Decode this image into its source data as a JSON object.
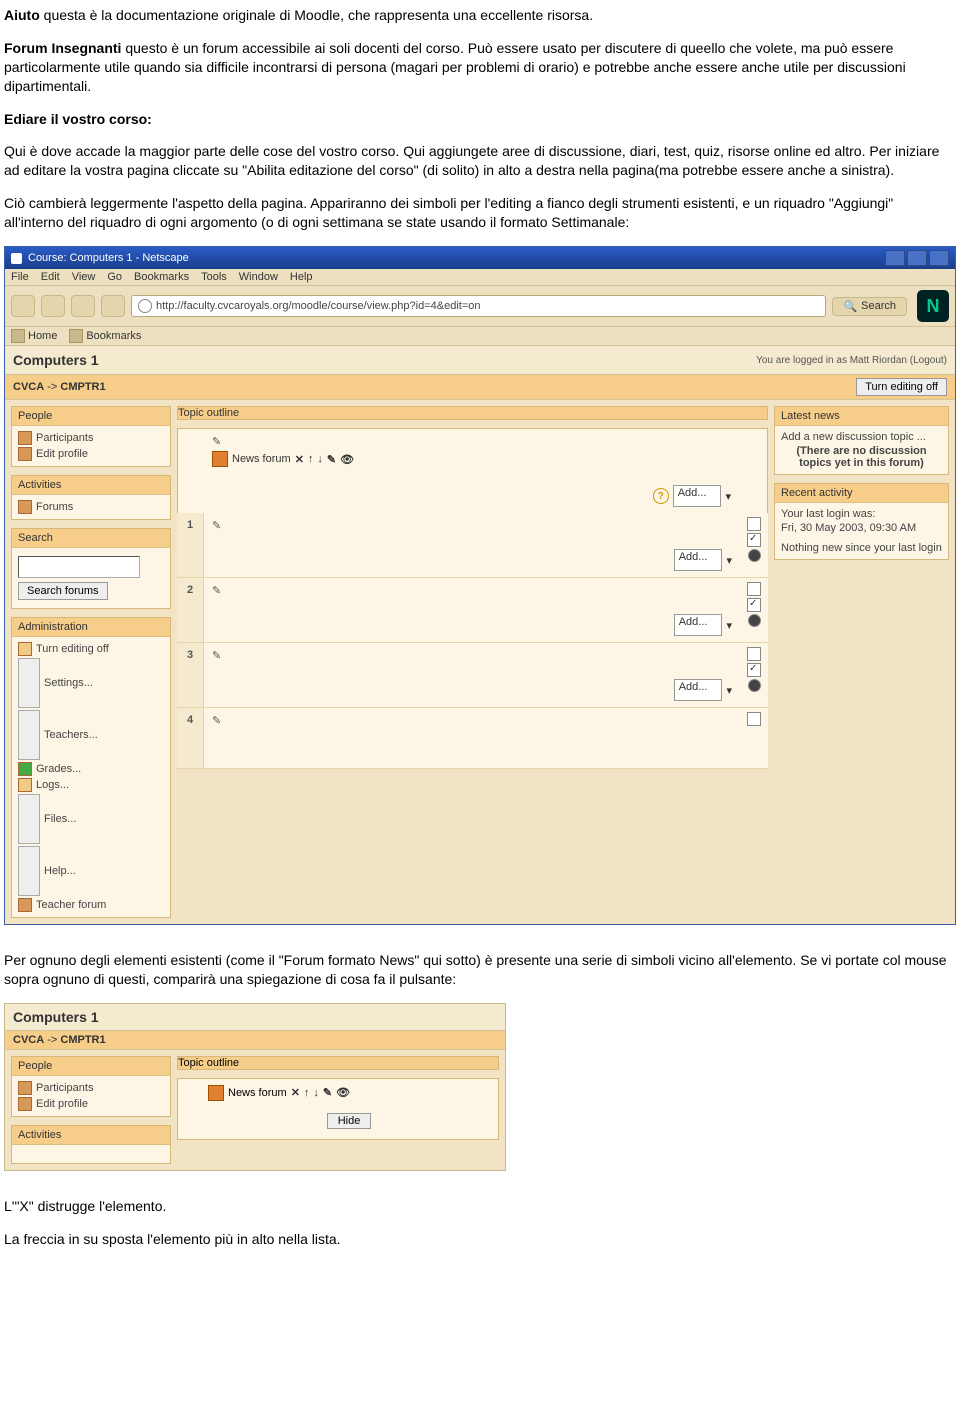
{
  "doc": {
    "p1_b": "Aiuto",
    "p1": " questa è la documentazione originale di Moodle, che rappresenta una eccellente risorsa.",
    "p2_b": "Forum Insegnanti",
    "p2": " questo è un forum accessibile ai soli docenti del corso. Può essere usato per discutere di queello che volete, ma può essere particolarmente utile quando sia difficile incontrarsi di persona (magari per problemi di orario) e potrebbe anche essere anche utile per discussioni dipartimentali.",
    "h1": "Ediare il vostro corso:",
    "p3": "Qui è dove accade la maggior parte delle cose del vostro corso. Qui aggiungete aree di discussione, diari, test, quiz, risorse online ed altro. Per iniziare ad editare la vostra pagina cliccate su \"Abilita editazione del corso\" (di solito) in alto a destra nella pagina(ma potrebbe essere anche a sinistra).",
    "p4": "Ciò cambierà leggermente l'aspetto della pagina. Appariranno dei simboli per l'editing a fianco degli strumenti esistenti, e un riquadro \"Aggiungi\" all'interno del riquadro di ogni argomento (o di ogni settimana se state usando il formato Settimanale:",
    "p5": "Per ognuno degli elementi esistenti (come il \"Forum formato News\" qui sotto) è presente una serie di simboli vicino all'elemento. Se vi portate col mouse sopra ognuno di questi, comparirà una spiegazione di cosa fa il pulsante:",
    "p6": "L'\"X\" distrugge l'elemento.",
    "p7": "La freccia in su sposta l'elemento più in alto nella lista."
  },
  "ss1": {
    "title": "Course: Computers 1 - Netscape",
    "menu": [
      "File",
      "Edit",
      "View",
      "Go",
      "Bookmarks",
      "Tools",
      "Window",
      "Help"
    ],
    "url": "http://faculty.cvcaroyals.org/moodle/course/view.php?id=4&edit=on",
    "search": "Search",
    "tabs": {
      "home": "Home",
      "bm": "Bookmarks"
    },
    "course": "Computers 1",
    "logged": "You are logged in as Matt Riordan (Logout)",
    "crumb1": "CVCA",
    "crumbsep": " -> ",
    "crumb2": "CMPTR1",
    "editoff": "Turn editing off",
    "people": {
      "h": "People",
      "items": [
        "Participants",
        "Edit profile"
      ]
    },
    "activities": {
      "h": "Activities",
      "items": [
        "Forums"
      ]
    },
    "searchp": {
      "h": "Search",
      "btn": "Search forums"
    },
    "admin": {
      "h": "Administration",
      "items": [
        "Turn editing off",
        "Settings...",
        "Teachers...",
        "Grades...",
        "Logs...",
        "Files...",
        "Help...",
        "Teacher forum"
      ]
    },
    "topic": {
      "h": "Topic outline",
      "newsforum": "News forum",
      "add": "Add..."
    },
    "latest": {
      "h": "Latest news",
      "add": "Add a new discussion topic ...",
      "none": "(There are no discussion topics yet in this forum)"
    },
    "recent": {
      "h": "Recent activity",
      "login": "Your last login was:",
      "date": "Fri, 30 May 2003, 09:30 AM",
      "nothing": "Nothing new since your last login"
    }
  },
  "ss2": {
    "course": "Computers 1",
    "crumb1": "CVCA",
    "crumbsep": " -> ",
    "crumb2": "CMPTR1",
    "people": {
      "h": "People",
      "items": [
        "Participants",
        "Edit profile"
      ]
    },
    "activities": {
      "h": "Activities"
    },
    "topic": {
      "h": "Topic outline",
      "newsforum": "News forum",
      "hide": "Hide"
    }
  }
}
